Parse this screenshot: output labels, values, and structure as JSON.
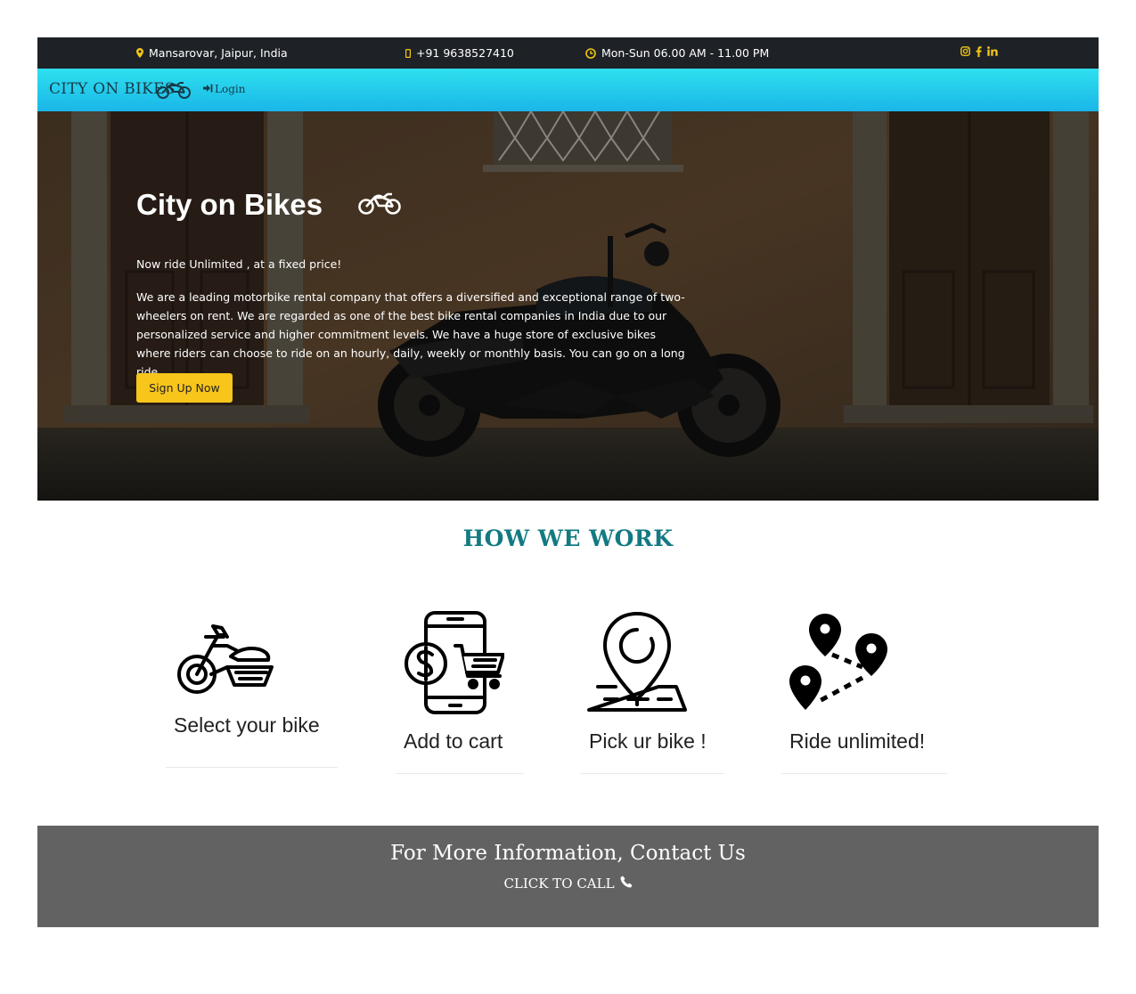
{
  "topbar": {
    "location": "Mansarovar, Jaipur, India",
    "phone": "+91 9638527410",
    "hours": "Mon-Sun 06.00 AM - 11.00 PM",
    "social_icons": [
      "instagram-icon",
      "facebook-icon",
      "linkedin-icon"
    ]
  },
  "nav": {
    "brand": "CITY ON BIKES",
    "login": "Login"
  },
  "hero": {
    "title": "City on Bikes",
    "tagline": "Now ride Unlimited , at a fixed price!",
    "description": "We are a leading motorbike rental company that offers a diversified and exceptional range of two-wheelers on rent. We are regarded as one of the best bike rental companies in India due to our personalized service and higher commitment levels. We have a huge store of exclusive bikes where riders can choose to ride on an hourly, daily, weekly or monthly basis. You can go on a long ride.",
    "cta": "Sign Up Now"
  },
  "how": {
    "title": "HOW WE WORK",
    "steps": [
      {
        "label": "Select your bike",
        "icon": "motorbike-icon"
      },
      {
        "label": "Add to cart",
        "icon": "phone-cart-icon"
      },
      {
        "label": "Pick ur bike !",
        "icon": "map-pin-icon"
      },
      {
        "label": "Ride unlimited!",
        "icon": "route-pins-icon"
      }
    ]
  },
  "contact": {
    "title": "For More Information, Contact Us",
    "call": "CLICK TO CALL"
  },
  "colors": {
    "topbar": "#1e2227",
    "accent": "#f3c614",
    "nav_gradient_top": "#2fe0ee",
    "nav_gradient_bottom": "#1ab6e8",
    "section_title": "#137a82",
    "contact_bg": "#626262",
    "button": "#f8c51b"
  }
}
